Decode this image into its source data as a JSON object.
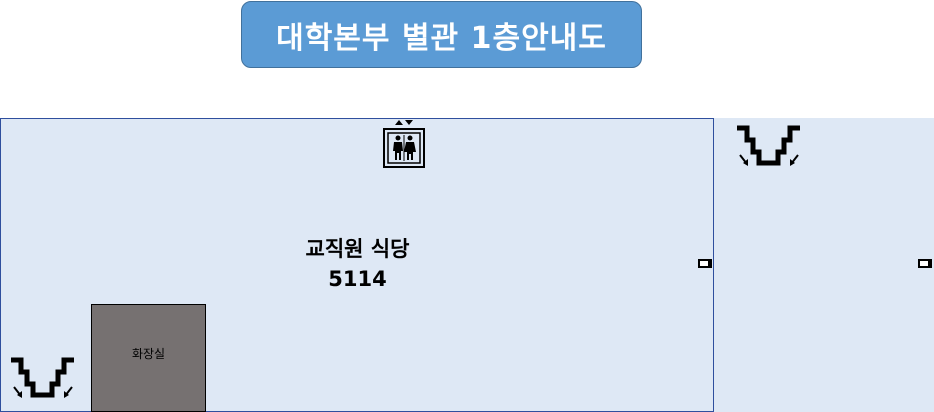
{
  "map": {
    "title": "대학본부 별관 1층안내도",
    "rooms": {
      "main": {
        "name": "교직원 식당",
        "number": "5114"
      },
      "restroom": {
        "name": "화장실"
      }
    },
    "icons": {
      "elevator": "elevator-icon",
      "stairs": "stairs-icon",
      "door": "door-icon"
    },
    "colors": {
      "title_bg": "#5b9bd5",
      "room_fill": "#dee8f5",
      "room_border": "#2f4f9e",
      "restroom_fill": "#767171"
    }
  }
}
